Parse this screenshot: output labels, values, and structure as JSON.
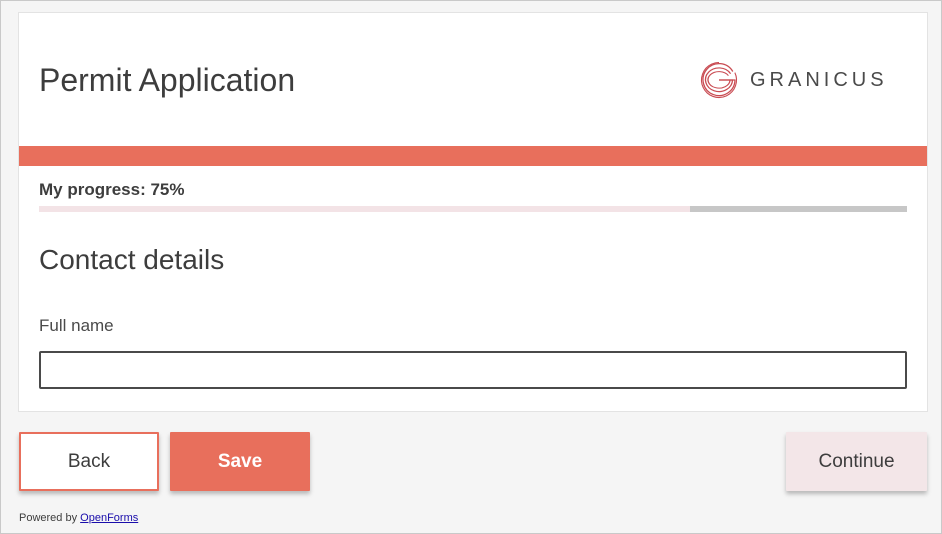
{
  "header": {
    "title": "Permit Application",
    "brand_name": "GRANICUS"
  },
  "progress": {
    "label": "My progress: 75%",
    "value_percent": 75
  },
  "section": {
    "title": "Contact details"
  },
  "form": {
    "full_name": {
      "label": "Full name",
      "value": "",
      "placeholder": ""
    }
  },
  "actions": {
    "back_label": "Back",
    "save_label": "Save",
    "continue_label": "Continue"
  },
  "footer": {
    "powered_by": "Powered by",
    "link_text": "OpenForms"
  },
  "colors": {
    "accent": "#e86f5c",
    "progress_fill": "#f3e3e6",
    "progress_track": "#c7c7c7",
    "continue_bg": "#f3e6e8"
  },
  "icons": {
    "brand_logo": "granicus-logo-icon"
  }
}
